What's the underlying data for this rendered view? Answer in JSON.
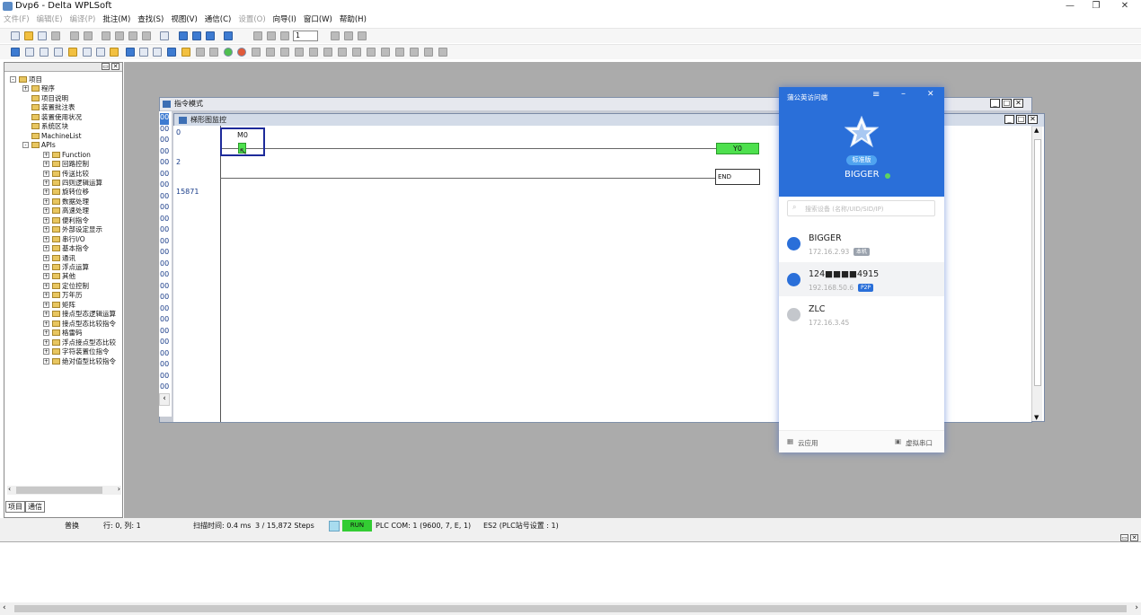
{
  "app": {
    "title": "Dvp6 - Delta WPLSoft"
  },
  "menu": [
    {
      "label": "文件(F)",
      "enabled": false
    },
    {
      "label": "编辑(E)",
      "enabled": false
    },
    {
      "label": "编译(P)",
      "enabled": false
    },
    {
      "label": "批注(M)",
      "enabled": true
    },
    {
      "label": "查找(S)",
      "enabled": true
    },
    {
      "label": "视图(V)",
      "enabled": true
    },
    {
      "label": "通信(C)",
      "enabled": true
    },
    {
      "label": "设置(O)",
      "enabled": false
    },
    {
      "label": "向导(I)",
      "enabled": true
    },
    {
      "label": "窗口(W)",
      "enabled": true
    },
    {
      "label": "帮助(H)",
      "enabled": true
    }
  ],
  "toolbar": {
    "zoom_value": "1"
  },
  "project_tree": {
    "items": [
      {
        "label": "项目",
        "level": 0,
        "expander": "-"
      },
      {
        "label": "程序",
        "level": 1,
        "expander": "+"
      },
      {
        "label": "项目说明",
        "level": 1,
        "expander": ""
      },
      {
        "label": "装置批注表",
        "level": 1,
        "expander": ""
      },
      {
        "label": "装置使用状况",
        "level": 1,
        "expander": ""
      },
      {
        "label": "系统区块",
        "level": 1,
        "expander": ""
      },
      {
        "label": "MachineList",
        "level": 1,
        "expander": ""
      },
      {
        "label": "APIs",
        "level": 1,
        "expander": "-"
      },
      {
        "label": "Function",
        "level": 2,
        "expander": "+"
      },
      {
        "label": "回路控制",
        "level": 2,
        "expander": "+"
      },
      {
        "label": "传送比较",
        "level": 2,
        "expander": "+"
      },
      {
        "label": "四则逻辑运算",
        "level": 2,
        "expander": "+"
      },
      {
        "label": "旋转位移",
        "level": 2,
        "expander": "+"
      },
      {
        "label": "数据处理",
        "level": 2,
        "expander": "+"
      },
      {
        "label": "高速处理",
        "level": 2,
        "expander": "+"
      },
      {
        "label": "便利指令",
        "level": 2,
        "expander": "+"
      },
      {
        "label": "外部设定显示",
        "level": 2,
        "expander": "+"
      },
      {
        "label": "串行I/O",
        "level": 2,
        "expander": "+"
      },
      {
        "label": "基本指令",
        "level": 2,
        "expander": "+"
      },
      {
        "label": "通讯",
        "level": 2,
        "expander": "+"
      },
      {
        "label": "浮点运算",
        "level": 2,
        "expander": "+"
      },
      {
        "label": "其他",
        "level": 2,
        "expander": "+"
      },
      {
        "label": "定位控制",
        "level": 2,
        "expander": "+"
      },
      {
        "label": "万年历",
        "level": 2,
        "expander": "+"
      },
      {
        "label": "矩阵",
        "level": 2,
        "expander": "+"
      },
      {
        "label": "接点型态逻辑运算",
        "level": 2,
        "expander": "+"
      },
      {
        "label": "接点型态比较指令",
        "level": 2,
        "expander": "+"
      },
      {
        "label": "格雷码",
        "level": 2,
        "expander": "+"
      },
      {
        "label": "浮点接点型态比较",
        "level": 2,
        "expander": "+"
      },
      {
        "label": "字符装置位指令",
        "level": 2,
        "expander": "+"
      },
      {
        "label": "绝对值型比较指令",
        "level": 2,
        "expander": "+"
      }
    ],
    "tabs": [
      "项目",
      "通信"
    ]
  },
  "windows": {
    "instruction_mode": {
      "title": "指令模式",
      "line_prefix": "00"
    },
    "ladder_monitor": {
      "title": "梯形图监控"
    }
  },
  "ladder": {
    "step_numbers": [
      "0",
      "2",
      "15871"
    ],
    "contact_label": "M0",
    "coil_label": "Y0",
    "end_label": "END"
  },
  "status_bar": {
    "mode": "普换",
    "position": "行: 0, 列: 1",
    "scan_time": "扫描时间: 0.4 ms",
    "steps": "3 / 15,872 Steps",
    "run": "RUN",
    "comm": "PLC COM: 1 (9600, 7, E, 1)",
    "station": "ES2 (PLC站号设置 : 1)"
  },
  "remote_popup": {
    "title": "蒲公英访问端",
    "edition_badge": "标准版",
    "account_name": "BIGGER",
    "search_placeholder": "搜索设备 (名称/UID/SID/IP)",
    "devices": [
      {
        "name": "BIGGER",
        "ip": "172.16.2.93",
        "tag": "本机",
        "tag_color": "#9aa2ad",
        "avatar_color": "#2a6fd9",
        "selected": false
      },
      {
        "name": "124■■■■4915",
        "ip": "192.168.50.6",
        "tag": "P2P",
        "tag_color": "#2a6fd9",
        "avatar_color": "#2a6fd9",
        "selected": true
      },
      {
        "name": "ZLC",
        "ip": "172.16.3.45",
        "tag": "",
        "tag_color": "",
        "avatar_color": "#c4c7cc",
        "selected": false
      }
    ],
    "footer": {
      "cloud_apps": "云应用",
      "virtual_serial": "虚拟串口"
    }
  },
  "colors": {
    "brand_blue": "#2a6fd9",
    "run_green": "#33cc33",
    "coil_green": "#4ee04e"
  }
}
